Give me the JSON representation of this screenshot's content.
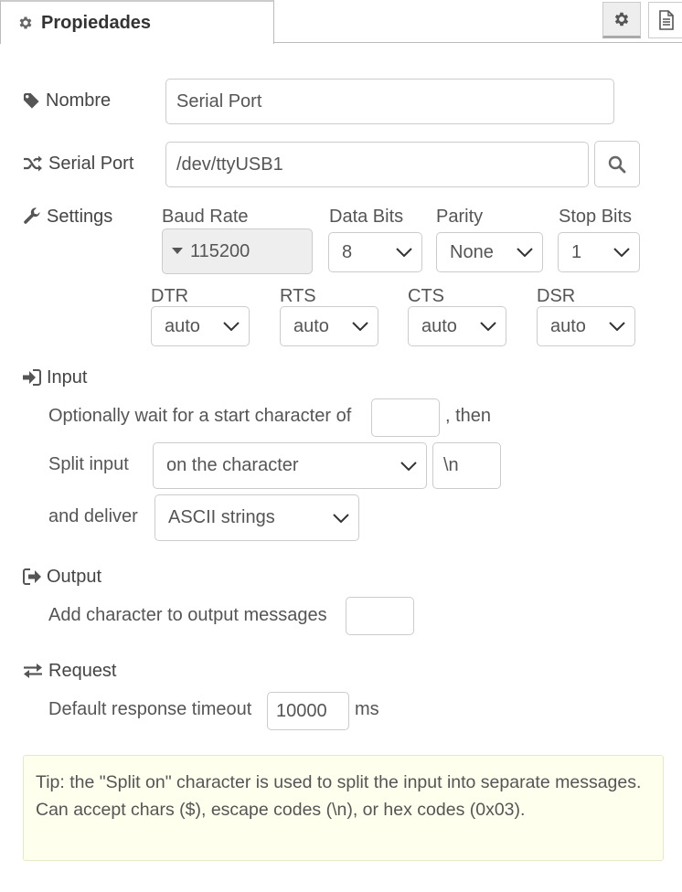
{
  "tabs": {
    "active_label": "Propiedades"
  },
  "fields": {
    "name": {
      "label": "Nombre",
      "value": "Serial Port"
    },
    "serial_port": {
      "label": "Serial Port",
      "value": "/dev/ttyUSB1"
    },
    "settings": {
      "label": "Settings",
      "baud_rate": {
        "label": "Baud Rate",
        "value": "115200"
      },
      "data_bits": {
        "label": "Data Bits",
        "value": "8"
      },
      "parity": {
        "label": "Parity",
        "value": "None"
      },
      "stop_bits": {
        "label": "Stop Bits",
        "value": "1"
      },
      "dtr": {
        "label": "DTR",
        "value": "auto"
      },
      "rts": {
        "label": "RTS",
        "value": "auto"
      },
      "cts": {
        "label": "CTS",
        "value": "auto"
      },
      "dsr": {
        "label": "DSR",
        "value": "auto"
      }
    }
  },
  "input_section": {
    "heading": "Input",
    "wait_text": "Optionally wait for a start character of",
    "wait_value": "",
    "then_text": ", then",
    "split_label": "Split input",
    "split_value": "on the character",
    "split_char": "\\n",
    "deliver_label": "and deliver",
    "deliver_value": "ASCII strings"
  },
  "output_section": {
    "heading": "Output",
    "add_char_text": "Add character to output messages",
    "add_char_value": ""
  },
  "request_section": {
    "heading": "Request",
    "timeout_text": "Default response timeout",
    "timeout_value": "10000",
    "timeout_unit": "ms"
  },
  "tip": "Tip: the \"Split on\" character is used to split the input into separate messages. Can accept chars ($), escape codes (\\n), or hex codes (0x03).",
  "icons": [
    "gear-icon",
    "document-icon",
    "tag-icon",
    "shuffle-icon",
    "wrench-icon",
    "sign-in-icon",
    "sign-out-icon",
    "exchange-icon",
    "search-icon",
    "caret-down-icon",
    "chevron-down-icon"
  ]
}
